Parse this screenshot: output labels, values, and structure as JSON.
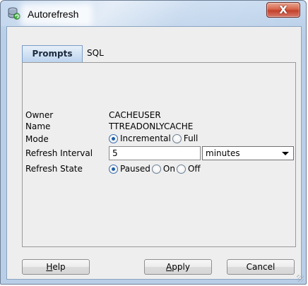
{
  "window": {
    "title": "Autorefresh",
    "close_glyph": "X"
  },
  "tabs": [
    {
      "label": "Prompts",
      "selected": true
    },
    {
      "label": "SQL",
      "selected": false
    }
  ],
  "form": {
    "owner": {
      "label": "Owner",
      "value": "CACHEUSER"
    },
    "name": {
      "label": "Name",
      "value": "TTREADONLYCACHE"
    },
    "mode": {
      "label": "Mode",
      "options": [
        {
          "label": "Incremental",
          "selected": true
        },
        {
          "label": "Full",
          "selected": false
        }
      ]
    },
    "refresh_interval": {
      "label": "Refresh Interval",
      "value": "5",
      "unit": "minutes"
    },
    "refresh_state": {
      "label": "Refresh State",
      "options": [
        {
          "label": "Paused",
          "selected": true
        },
        {
          "label": "On",
          "selected": false
        },
        {
          "label": "Off",
          "selected": false
        }
      ]
    }
  },
  "buttons": {
    "help": {
      "mnemonic": "H",
      "rest": "elp"
    },
    "apply": {
      "mnemonic": "A",
      "rest": "pply"
    },
    "cancel": "Cancel"
  },
  "colors": {
    "titlebar": "#c7daf0",
    "close_button": "#c8452d",
    "selected_tab": "#bcd4ee",
    "radio_dot": "#1e5fa8"
  },
  "icons": {
    "app": "database-refresh-icon",
    "close": "close-icon",
    "dropdown": "chevron-down-icon"
  }
}
